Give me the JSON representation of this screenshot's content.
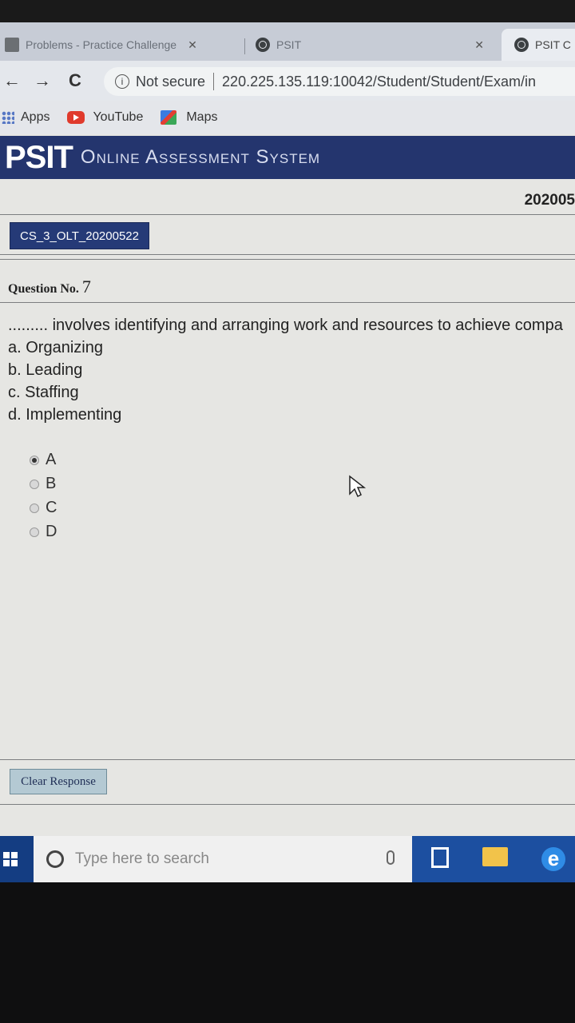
{
  "browser": {
    "tabs": [
      {
        "title": "Problems - Practice Challenge",
        "close": "✕"
      },
      {
        "title": "PSIT",
        "close": "✕"
      },
      {
        "title": "PSIT C"
      }
    ],
    "nav": {
      "back": "←",
      "forward": "→",
      "reload": "C"
    },
    "security": "Not secure",
    "url": "220.225.135.119:10042/Student/Student/Exam/in",
    "bookmarks": [
      "Apps",
      "YouTube",
      "Maps"
    ]
  },
  "header": {
    "brand": "PSIT",
    "system": "Online Assessment System"
  },
  "exam_id": "202005",
  "test_badge": "CS_3_OLT_20200522",
  "question": {
    "label": "Question No.",
    "number": "7",
    "text": "......... involves identifying and arranging work and resources to achieve compa",
    "options": [
      "a. Organizing",
      "b. Leading",
      "c. Staffing",
      "d. Implementing"
    ]
  },
  "answers": {
    "choices": [
      "A",
      "B",
      "C",
      "D"
    ],
    "selected": "A"
  },
  "buttons": {
    "clear_response": "Clear Response"
  },
  "taskbar": {
    "search_placeholder": "Type here to search",
    "edge": "e"
  }
}
